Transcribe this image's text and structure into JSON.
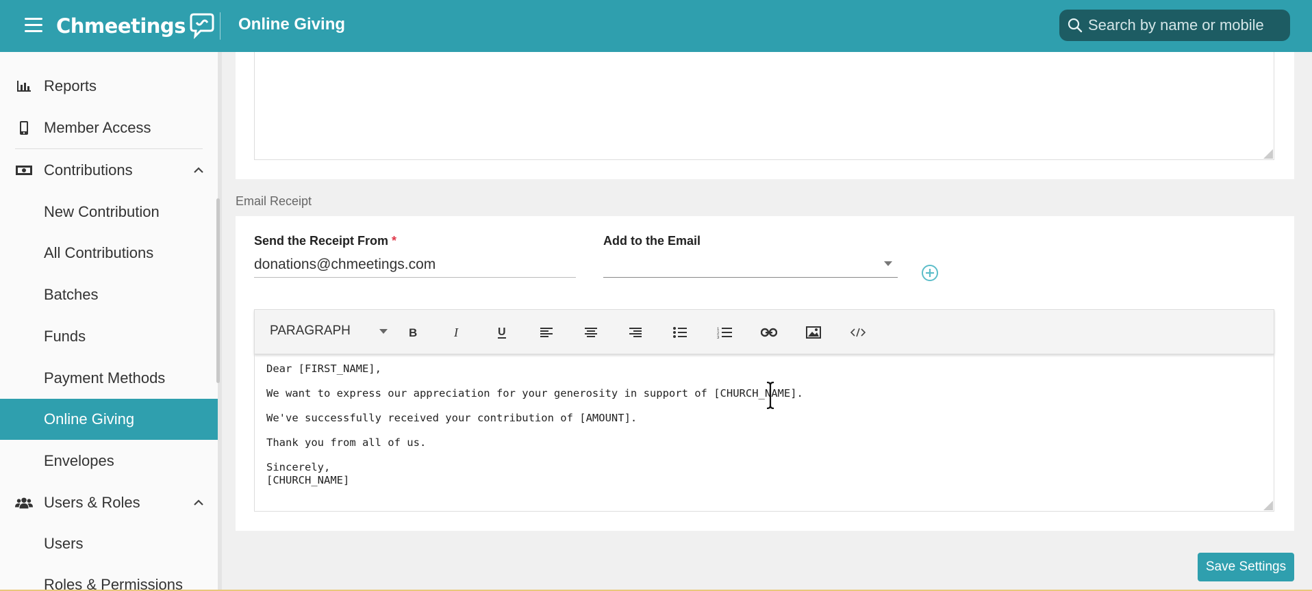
{
  "header": {
    "app_name": "Chmeetings",
    "title": "Online Giving",
    "search_placeholder": "Search by name or mobile"
  },
  "sidebar": {
    "items": [
      {
        "label": "Reports",
        "icon": "bar-chart-icon"
      },
      {
        "label": "Member Access",
        "icon": "mobile-icon"
      },
      {
        "label": "Contributions",
        "icon": "money-icon",
        "expanded": true
      },
      {
        "label": "New Contribution"
      },
      {
        "label": "All Contributions"
      },
      {
        "label": "Batches"
      },
      {
        "label": "Funds"
      },
      {
        "label": "Payment Methods"
      },
      {
        "label": "Online Giving",
        "active": true
      },
      {
        "label": "Envelopes"
      },
      {
        "label": "Users & Roles",
        "icon": "users-icon",
        "expanded": true
      },
      {
        "label": "Users"
      },
      {
        "label": "Roles & Permissions"
      }
    ]
  },
  "email_receipt": {
    "section_label": "Email Receipt",
    "from_label": "Send the Receipt From",
    "from_required": "*",
    "from_value": "donations@chmeetings.com",
    "add_label": "Add to the Email",
    "add_value": ""
  },
  "editor": {
    "format_select": "PARAGRAPH",
    "toolbar_icons": [
      "bold-icon",
      "italic-icon",
      "underline-icon",
      "align-left-icon",
      "align-center-icon",
      "align-right-icon",
      "bullet-list-icon",
      "numbered-list-icon",
      "link-icon",
      "image-icon",
      "code-icon"
    ],
    "lines": [
      "Dear [FIRST_NAME],",
      "We want to express our appreciation for your generosity in support of [CHURCH_NAME].",
      "We've successfully received your contribution of [AMOUNT].",
      "Thank you from all of us.",
      "Sincerely,",
      "[CHURCH_NAME]"
    ]
  },
  "actions": {
    "save_label": "Save Settings"
  },
  "colors": {
    "brand": "#2f9fae",
    "search_bg": "#1d5c63",
    "required": "#e0394a"
  }
}
